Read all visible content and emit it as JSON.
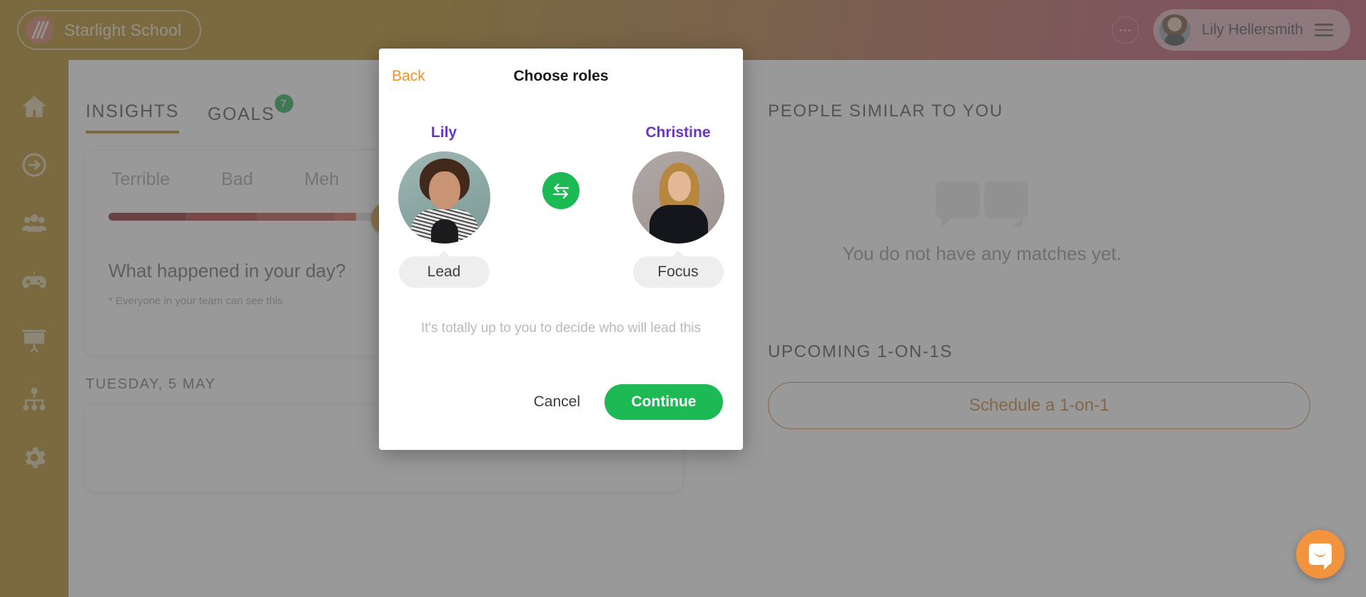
{
  "topbar": {
    "brand_name": "Starlight School",
    "brand_logo_icon": "slash-logo-icon",
    "more_icon": "ellipsis-icon",
    "user_name": "Lily Hellersmith",
    "avatar_icon": "user-avatar-icon",
    "menu_icon": "hamburger-menu-icon"
  },
  "sidebar": {
    "items": [
      {
        "icon": "home-icon",
        "label": "Home"
      },
      {
        "icon": "arrow-circle-right-icon",
        "label": "Check-in"
      },
      {
        "icon": "people-group-icon",
        "label": "Team"
      },
      {
        "icon": "gamepad-icon",
        "label": "Games"
      },
      {
        "icon": "presentation-board-icon",
        "label": "Presentations"
      },
      {
        "icon": "org-chart-icon",
        "label": "Org chart"
      },
      {
        "icon": "gear-icon",
        "label": "Settings"
      }
    ]
  },
  "tabs": [
    {
      "label": "INSIGHTS",
      "active": true,
      "badge": ""
    },
    {
      "label": "GOALS",
      "active": false,
      "badge": "7"
    }
  ],
  "mood_card": {
    "scale_labels": [
      "Terrible",
      "Bad",
      "Meh"
    ],
    "segment_colors": [
      "#7e1f26",
      "#a32b2f",
      "#b4453f",
      "#c35a48"
    ],
    "knob_color": "#d79434",
    "question": "What happened in your day?",
    "note": "* Everyone in your team can see this"
  },
  "day_section": {
    "label": "TUESDAY, 5 MAY"
  },
  "right_panel": {
    "similar_title": "PEOPLE SIMILAR TO YOU",
    "empty_icon": "speech-bubbles-icon",
    "empty_text": "You do not have any matches yet.",
    "upcoming_title": "UPCOMING 1-ON-1S",
    "schedule_label": "Schedule a 1-on-1"
  },
  "modal": {
    "back_label": "Back",
    "title": "Choose roles",
    "people": [
      {
        "name": "Lily",
        "role": "Lead",
        "photo_icon": "lily-portrait-icon"
      },
      {
        "name": "Christine",
        "role": "Focus",
        "photo_icon": "christine-portrait-icon"
      }
    ],
    "swap_icon": "swap-arrows-icon",
    "hint": "It's totally up to you to decide who will lead this",
    "cancel_label": "Cancel",
    "continue_label": "Continue",
    "accent_green": "#1db954",
    "name_color": "#6a35c6",
    "back_color": "#f0932b"
  },
  "intercom": {
    "icon": "intercom-chat-icon"
  }
}
